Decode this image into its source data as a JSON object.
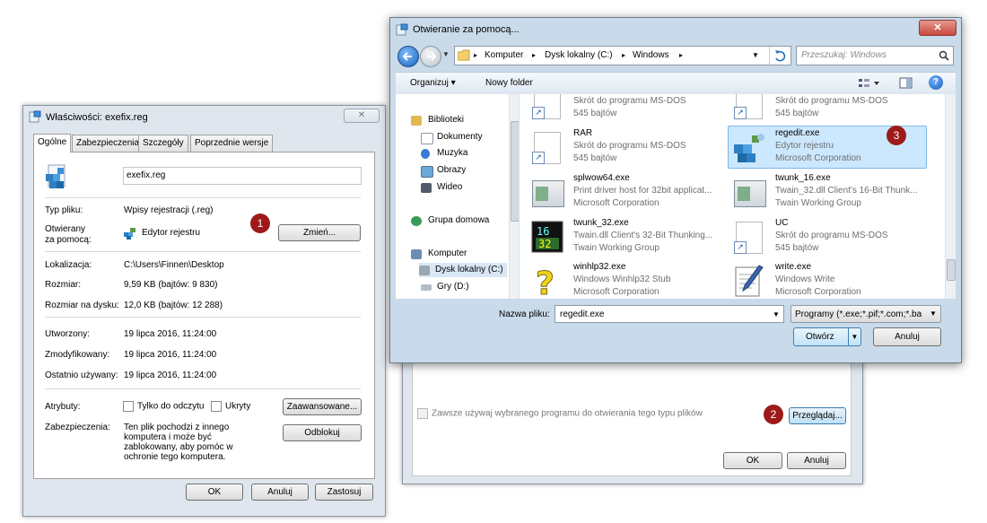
{
  "properties_dialog": {
    "title": "Właściwości: exefix.reg",
    "close_glyph": "✕",
    "tabs": [
      "Ogólne",
      "Zabezpieczenia",
      "Szczegóły",
      "Poprzednie wersje"
    ],
    "file_name": "exefix.reg",
    "type_label": "Typ pliku:",
    "type_value": "Wpisy rejestracji (.reg)",
    "opens_with_label_1": "Otwierany",
    "opens_with_label_2": "za pomocą:",
    "opens_with_value": "Edytor rejestru",
    "change_button": "Zmień...",
    "location_label": "Lokalizacja:",
    "location_value": "C:\\Users\\Finnen\\Desktop",
    "size_label": "Rozmiar:",
    "size_value": "9,59 KB (bajtów: 9 830)",
    "size_on_disk_label": "Rozmiar na dysku:",
    "size_on_disk_value": "12,0 KB (bajtów: 12 288)",
    "created_label": "Utworzony:",
    "created_value": "19 lipca 2016, 11:24:00",
    "modified_label": "Zmodyfikowany:",
    "modified_value": "19 lipca 2016, 11:24:00",
    "accessed_label": "Ostatnio używany:",
    "accessed_value": "19 lipca 2016, 11:24:00",
    "attributes_label": "Atrybuty:",
    "readonly_label": "Tylko do odczytu",
    "hidden_label": "Ukryty",
    "advanced_button": "Zaawansowane...",
    "security_label": "Zabezpieczenia:",
    "security_text_1": "Ten plik pochodzi z innego",
    "security_text_2": "komputera i może być",
    "security_text_3": "zablokowany, aby pomóc w",
    "security_text_4": "ochronie tego komputera.",
    "unblock_button": "Odblokuj",
    "ok_button": "OK",
    "cancel_button": "Anuluj",
    "apply_button": "Zastosuj"
  },
  "open_with_dialog": {
    "always_use_label": "Zawsze używaj wybranego programu do otwierania tego typu plików",
    "browse_button": "Przeglądaj...",
    "ok_button": "OK",
    "cancel_button": "Anuluj"
  },
  "open_dialog": {
    "title": "Otwieranie za pomocą...",
    "close_glyph": "✕",
    "breadcrumb": [
      "Komputer",
      "Dysk lokalny (C:)",
      "Windows"
    ],
    "search_placeholder": "Przeszukaj: Windows",
    "organize_label": "Organizuj ▾",
    "new_folder_label": "Nowy folder",
    "nav": {
      "libraries": "Biblioteki",
      "documents": "Dokumenty",
      "music": "Muzyka",
      "pictures": "Obrazy",
      "videos": "Wideo",
      "homegroup": "Grupa domowa",
      "computer": "Komputer",
      "local_disk": "Dysk lokalny (C:)",
      "games": "Gry (D:)"
    },
    "files": [
      {
        "name": "",
        "line2": "Skrót do programu MS-DOS",
        "line3": "545 bajtów"
      },
      {
        "name": "",
        "line2": "Skrót do programu MS-DOS",
        "line3": "545 bajtów"
      },
      {
        "name": "RAR",
        "line2": "Skrót do programu MS-DOS",
        "line3": "545 bajtów"
      },
      {
        "name": "regedit.exe",
        "line2": "Edytor rejestru",
        "line3": "Microsoft Corporation"
      },
      {
        "name": "splwow64.exe",
        "line2": "Print driver host for 32bit applicat...",
        "line3": "Microsoft Corporation"
      },
      {
        "name": "twunk_16.exe",
        "line2": "Twain_32.dll Client's 16-Bit Thunk...",
        "line3": "Twain Working Group"
      },
      {
        "name": "twunk_32.exe",
        "line2": "Twain.dll Client's 32-Bit Thunking...",
        "line3": "Twain Working Group"
      },
      {
        "name": "UC",
        "line2": "Skrót do programu MS-DOS",
        "line3": "545 bajtów"
      },
      {
        "name": "winhlp32.exe",
        "line2": "Windows Winhlp32 Stub",
        "line3": "Microsoft Corporation"
      },
      {
        "name": "write.exe",
        "line2": "Windows Write",
        "line3": "Microsoft Corporation"
      }
    ],
    "filename_label": "Nazwa pliku:",
    "filename_value": "regedit.exe",
    "filetype_value": "Programy (*.exe;*.pif;*.com;*.ba",
    "open_button": "Otwórz",
    "cancel_button": "Anuluj"
  },
  "badges": [
    "1",
    "2",
    "3"
  ],
  "colors": {
    "badge": "#9e1a1a",
    "selection": "#cce8ff",
    "close_button": "#c9483c"
  }
}
